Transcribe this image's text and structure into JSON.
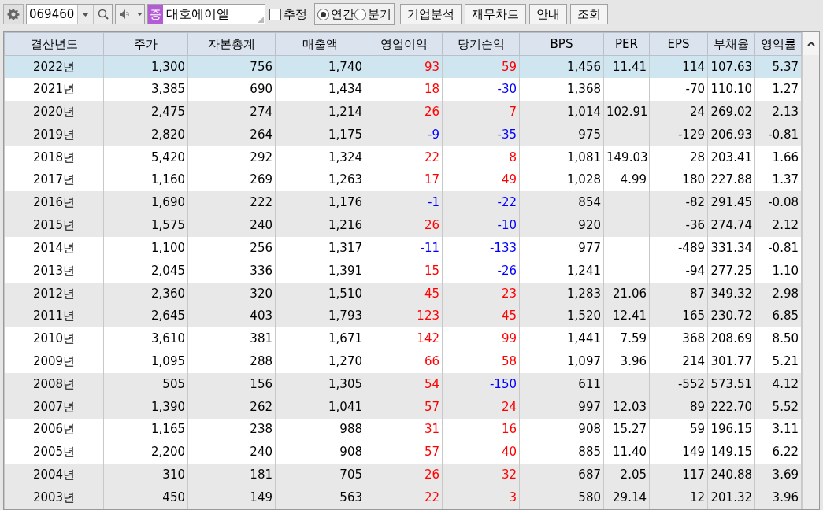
{
  "toolbar": {
    "code": "069460",
    "market_badge": "증",
    "company": "대호에이엘",
    "estimate": {
      "label": "추정",
      "checked": false
    },
    "period": [
      {
        "label": "연간",
        "selected": true
      },
      {
        "label": "분기",
        "selected": false
      }
    ],
    "buttons": [
      "기업분석",
      "재무차트",
      "안내",
      "조회"
    ]
  },
  "table": {
    "columns": [
      "결산년도",
      "주가",
      "자본총계",
      "매출액",
      "영업이익",
      "당기순익",
      "BPS",
      "PER",
      "EPS",
      "부채율",
      "영익률"
    ],
    "rows": [
      {
        "selected": true,
        "cells": [
          {
            "text": "2022년"
          },
          {
            "text": "1,300"
          },
          {
            "text": "756"
          },
          {
            "text": "1,740"
          },
          {
            "text": "93",
            "color": "#ff0000"
          },
          {
            "text": "59",
            "color": "#ff0000"
          },
          {
            "text": "1,456"
          },
          {
            "text": "11.41"
          },
          {
            "text": "114"
          },
          {
            "text": "107.63"
          },
          {
            "text": "5.37"
          }
        ]
      },
      {
        "selected": false,
        "cells": [
          {
            "text": "2021년"
          },
          {
            "text": "3,385"
          },
          {
            "text": "690"
          },
          {
            "text": "1,434"
          },
          {
            "text": "18",
            "color": "#ff0000"
          },
          {
            "text": "-30",
            "color": "#0000ff"
          },
          {
            "text": "1,368"
          },
          {
            "text": ""
          },
          {
            "text": "-70"
          },
          {
            "text": "110.10"
          },
          {
            "text": "1.27"
          }
        ]
      },
      {
        "selected": false,
        "cells": [
          {
            "text": "2020년"
          },
          {
            "text": "2,475"
          },
          {
            "text": "274"
          },
          {
            "text": "1,214"
          },
          {
            "text": "26",
            "color": "#ff0000"
          },
          {
            "text": "7",
            "color": "#ff0000"
          },
          {
            "text": "1,014"
          },
          {
            "text": "102.91"
          },
          {
            "text": "24"
          },
          {
            "text": "269.02"
          },
          {
            "text": "2.13"
          }
        ]
      },
      {
        "selected": false,
        "cells": [
          {
            "text": "2019년"
          },
          {
            "text": "2,820"
          },
          {
            "text": "264"
          },
          {
            "text": "1,175"
          },
          {
            "text": "-9",
            "color": "#0000ff"
          },
          {
            "text": "-35",
            "color": "#0000ff"
          },
          {
            "text": "975"
          },
          {
            "text": ""
          },
          {
            "text": "-129"
          },
          {
            "text": "206.93"
          },
          {
            "text": "-0.81"
          }
        ]
      },
      {
        "selected": false,
        "cells": [
          {
            "text": "2018년"
          },
          {
            "text": "5,420"
          },
          {
            "text": "292"
          },
          {
            "text": "1,324"
          },
          {
            "text": "22",
            "color": "#ff0000"
          },
          {
            "text": "8",
            "color": "#ff0000"
          },
          {
            "text": "1,081"
          },
          {
            "text": "149.03"
          },
          {
            "text": "28"
          },
          {
            "text": "203.41"
          },
          {
            "text": "1.66"
          }
        ]
      },
      {
        "selected": false,
        "cells": [
          {
            "text": "2017년"
          },
          {
            "text": "1,160"
          },
          {
            "text": "269"
          },
          {
            "text": "1,263"
          },
          {
            "text": "17",
            "color": "#ff0000"
          },
          {
            "text": "49",
            "color": "#ff0000"
          },
          {
            "text": "1,028"
          },
          {
            "text": "4.99"
          },
          {
            "text": "180"
          },
          {
            "text": "227.88"
          },
          {
            "text": "1.37"
          }
        ]
      },
      {
        "selected": false,
        "cells": [
          {
            "text": "2016년"
          },
          {
            "text": "1,690"
          },
          {
            "text": "222"
          },
          {
            "text": "1,176"
          },
          {
            "text": "-1",
            "color": "#0000ff"
          },
          {
            "text": "-22",
            "color": "#0000ff"
          },
          {
            "text": "854"
          },
          {
            "text": ""
          },
          {
            "text": "-82"
          },
          {
            "text": "291.45"
          },
          {
            "text": "-0.08"
          }
        ]
      },
      {
        "selected": false,
        "cells": [
          {
            "text": "2015년"
          },
          {
            "text": "1,575"
          },
          {
            "text": "240"
          },
          {
            "text": "1,216"
          },
          {
            "text": "26",
            "color": "#ff0000"
          },
          {
            "text": "-10",
            "color": "#0000ff"
          },
          {
            "text": "920"
          },
          {
            "text": ""
          },
          {
            "text": "-36"
          },
          {
            "text": "274.74"
          },
          {
            "text": "2.12"
          }
        ]
      },
      {
        "selected": false,
        "cells": [
          {
            "text": "2014년"
          },
          {
            "text": "1,100"
          },
          {
            "text": "256"
          },
          {
            "text": "1,317"
          },
          {
            "text": "-11",
            "color": "#0000ff"
          },
          {
            "text": "-133",
            "color": "#0000ff"
          },
          {
            "text": "977"
          },
          {
            "text": ""
          },
          {
            "text": "-489"
          },
          {
            "text": "331.34"
          },
          {
            "text": "-0.81"
          }
        ]
      },
      {
        "selected": false,
        "cells": [
          {
            "text": "2013년"
          },
          {
            "text": "2,045"
          },
          {
            "text": "336"
          },
          {
            "text": "1,391"
          },
          {
            "text": "15",
            "color": "#ff0000"
          },
          {
            "text": "-26",
            "color": "#0000ff"
          },
          {
            "text": "1,241"
          },
          {
            "text": ""
          },
          {
            "text": "-94"
          },
          {
            "text": "277.25"
          },
          {
            "text": "1.10"
          }
        ]
      },
      {
        "selected": false,
        "cells": [
          {
            "text": "2012년"
          },
          {
            "text": "2,360"
          },
          {
            "text": "320"
          },
          {
            "text": "1,510"
          },
          {
            "text": "45",
            "color": "#ff0000"
          },
          {
            "text": "23",
            "color": "#ff0000"
          },
          {
            "text": "1,283"
          },
          {
            "text": "21.06"
          },
          {
            "text": "87"
          },
          {
            "text": "349.32"
          },
          {
            "text": "2.98"
          }
        ]
      },
      {
        "selected": false,
        "cells": [
          {
            "text": "2011년"
          },
          {
            "text": "2,645"
          },
          {
            "text": "403"
          },
          {
            "text": "1,793"
          },
          {
            "text": "123",
            "color": "#ff0000"
          },
          {
            "text": "45",
            "color": "#ff0000"
          },
          {
            "text": "1,520"
          },
          {
            "text": "12.41"
          },
          {
            "text": "165"
          },
          {
            "text": "230.72"
          },
          {
            "text": "6.85"
          }
        ]
      },
      {
        "selected": false,
        "cells": [
          {
            "text": "2010년"
          },
          {
            "text": "3,610"
          },
          {
            "text": "381"
          },
          {
            "text": "1,671"
          },
          {
            "text": "142",
            "color": "#ff0000"
          },
          {
            "text": "99",
            "color": "#ff0000"
          },
          {
            "text": "1,441"
          },
          {
            "text": "7.59"
          },
          {
            "text": "368"
          },
          {
            "text": "208.69"
          },
          {
            "text": "8.50"
          }
        ]
      },
      {
        "selected": false,
        "cells": [
          {
            "text": "2009년"
          },
          {
            "text": "1,095"
          },
          {
            "text": "288"
          },
          {
            "text": "1,270"
          },
          {
            "text": "66",
            "color": "#ff0000"
          },
          {
            "text": "58",
            "color": "#ff0000"
          },
          {
            "text": "1,097"
          },
          {
            "text": "3.96"
          },
          {
            "text": "214"
          },
          {
            "text": "301.77"
          },
          {
            "text": "5.21"
          }
        ]
      },
      {
        "selected": false,
        "cells": [
          {
            "text": "2008년"
          },
          {
            "text": "505"
          },
          {
            "text": "156"
          },
          {
            "text": "1,305"
          },
          {
            "text": "54",
            "color": "#ff0000"
          },
          {
            "text": "-150",
            "color": "#0000ff"
          },
          {
            "text": "611"
          },
          {
            "text": ""
          },
          {
            "text": "-552"
          },
          {
            "text": "573.51"
          },
          {
            "text": "4.12"
          }
        ]
      },
      {
        "selected": false,
        "cells": [
          {
            "text": "2007년"
          },
          {
            "text": "1,390"
          },
          {
            "text": "262"
          },
          {
            "text": "1,041"
          },
          {
            "text": "57",
            "color": "#ff0000"
          },
          {
            "text": "24",
            "color": "#ff0000"
          },
          {
            "text": "997"
          },
          {
            "text": "12.03"
          },
          {
            "text": "89"
          },
          {
            "text": "222.70"
          },
          {
            "text": "5.52"
          }
        ]
      },
      {
        "selected": false,
        "cells": [
          {
            "text": "2006년"
          },
          {
            "text": "1,165"
          },
          {
            "text": "238"
          },
          {
            "text": "988"
          },
          {
            "text": "31",
            "color": "#ff0000"
          },
          {
            "text": "16",
            "color": "#ff0000"
          },
          {
            "text": "908"
          },
          {
            "text": "15.27"
          },
          {
            "text": "59"
          },
          {
            "text": "196.15"
          },
          {
            "text": "3.11"
          }
        ]
      },
      {
        "selected": false,
        "cells": [
          {
            "text": "2005년"
          },
          {
            "text": "2,200"
          },
          {
            "text": "240"
          },
          {
            "text": "908"
          },
          {
            "text": "57",
            "color": "#ff0000"
          },
          {
            "text": "40",
            "color": "#ff0000"
          },
          {
            "text": "885"
          },
          {
            "text": "11.40"
          },
          {
            "text": "149"
          },
          {
            "text": "149.15"
          },
          {
            "text": "6.22"
          }
        ]
      },
      {
        "selected": false,
        "cells": [
          {
            "text": "2004년"
          },
          {
            "text": "310"
          },
          {
            "text": "181"
          },
          {
            "text": "705"
          },
          {
            "text": "26",
            "color": "#ff0000"
          },
          {
            "text": "32",
            "color": "#ff0000"
          },
          {
            "text": "687"
          },
          {
            "text": "2.05"
          },
          {
            "text": "117"
          },
          {
            "text": "240.88"
          },
          {
            "text": "3.69"
          }
        ]
      },
      {
        "selected": false,
        "cells": [
          {
            "text": "2003년"
          },
          {
            "text": "450"
          },
          {
            "text": "149"
          },
          {
            "text": "563"
          },
          {
            "text": "22",
            "color": "#ff0000"
          },
          {
            "text": "3",
            "color": "#ff0000"
          },
          {
            "text": "580"
          },
          {
            "text": "29.14"
          },
          {
            "text": "12"
          },
          {
            "text": "201.32"
          },
          {
            "text": "3.96"
          }
        ]
      }
    ]
  }
}
